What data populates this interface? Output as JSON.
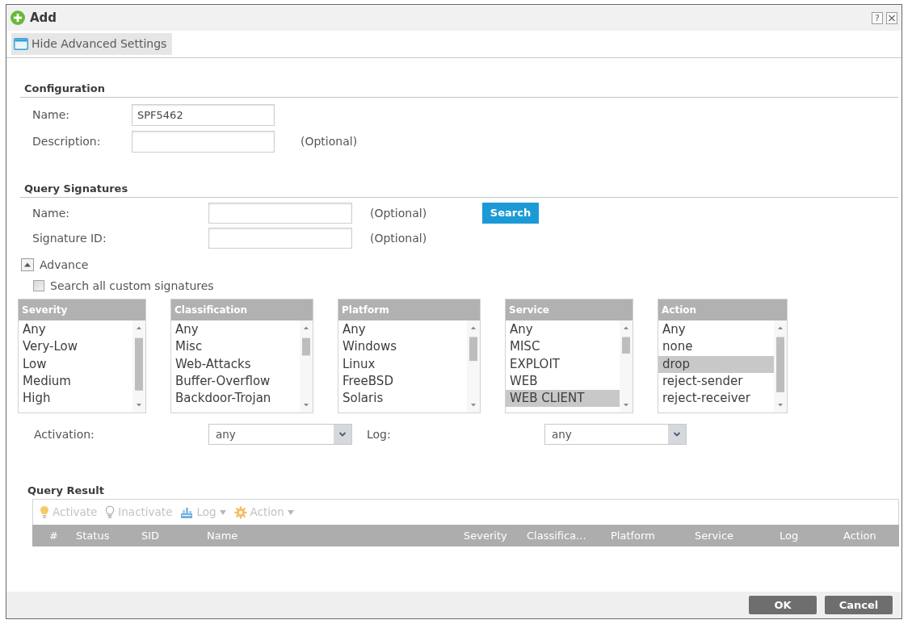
{
  "window": {
    "title": "Add",
    "help": "?"
  },
  "toolbar": {
    "toggle_label": "Hide Advanced Settings"
  },
  "configuration": {
    "heading": "Configuration",
    "fields": [
      {
        "label": "Name:",
        "value": "SPF5462"
      },
      {
        "label": "Description:",
        "note": "(Optional)"
      }
    ]
  },
  "query_signatures": {
    "heading": "Query Signatures",
    "fields": [
      {
        "label": "Name:",
        "note": "(Optional)"
      },
      {
        "label": "Signature ID:",
        "note": "(Optional)"
      }
    ],
    "search_button": "Search",
    "advance": {
      "label": "Advance",
      "expanded": true
    },
    "search_all_custom": {
      "label": "Search all custom signatures",
      "checked": false
    },
    "lists": [
      {
        "title": "Severity",
        "items": [
          {
            "label": "Any",
            "selected": false
          },
          {
            "label": "Very-Low",
            "selected": false
          },
          {
            "label": "Low",
            "selected": false
          },
          {
            "label": "Medium",
            "selected": false
          },
          {
            "label": "High",
            "selected": false
          }
        ]
      },
      {
        "title": "Classification",
        "items": [
          {
            "label": "Any",
            "selected": false
          },
          {
            "label": "Misc",
            "selected": false
          },
          {
            "label": "Web-Attacks",
            "selected": false
          },
          {
            "label": "Buffer-Overflow",
            "selected": false
          },
          {
            "label": "Backdoor-Trojan",
            "selected": false
          }
        ]
      },
      {
        "title": "Platform",
        "items": [
          {
            "label": "Any",
            "selected": false
          },
          {
            "label": "Windows",
            "selected": false
          },
          {
            "label": "Linux",
            "selected": false
          },
          {
            "label": "FreeBSD",
            "selected": false
          },
          {
            "label": "Solaris",
            "selected": false
          }
        ]
      },
      {
        "title": "Service",
        "items": [
          {
            "label": "Any",
            "selected": false
          },
          {
            "label": "MISC",
            "selected": false
          },
          {
            "label": "EXPLOIT",
            "selected": false
          },
          {
            "label": "WEB",
            "selected": false
          },
          {
            "label": "WEB CLIENT",
            "selected": true
          }
        ]
      },
      {
        "title": "Action",
        "items": [
          {
            "label": "Any",
            "selected": false
          },
          {
            "label": "none",
            "selected": false
          },
          {
            "label": "drop",
            "selected": true
          },
          {
            "label": "reject-sender",
            "selected": false
          },
          {
            "label": "reject-receiver",
            "selected": false
          }
        ]
      }
    ],
    "filters": [
      {
        "label": "Activation:",
        "value": "any"
      },
      {
        "label": "Log:",
        "value": "any"
      }
    ]
  },
  "query_result": {
    "heading": "Query Result",
    "actions": [
      {
        "label": "Activate",
        "kind": "button",
        "disabled": true
      },
      {
        "label": "Inactivate",
        "kind": "button",
        "disabled": true
      },
      {
        "label": "Log",
        "kind": "menu",
        "disabled": true
      },
      {
        "label": "Action",
        "kind": "menu",
        "disabled": true
      }
    ],
    "columns": [
      "#",
      "Status",
      "SID",
      "Name",
      "Severity",
      "Classifica...",
      "Platform",
      "Service",
      "Log",
      "Action"
    ]
  },
  "footer": {
    "buttons": [
      "OK",
      "Cancel"
    ]
  }
}
